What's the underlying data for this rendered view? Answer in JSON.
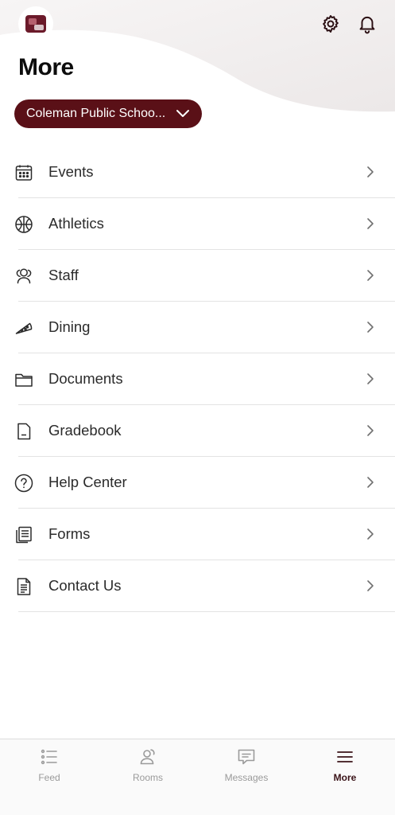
{
  "header": {
    "title": "More",
    "school_selector": "Coleman Public Schoo...",
    "icons": [
      "gear-icon",
      "bell-icon"
    ]
  },
  "menu": {
    "items": [
      {
        "label": "Events",
        "icon": "calendar-icon"
      },
      {
        "label": "Athletics",
        "icon": "basketball-icon"
      },
      {
        "label": "Staff",
        "icon": "staff-icon"
      },
      {
        "label": "Dining",
        "icon": "pizza-icon"
      },
      {
        "label": "Documents",
        "icon": "folder-icon"
      },
      {
        "label": "Gradebook",
        "icon": "gradebook-icon"
      },
      {
        "label": "Help Center",
        "icon": "help-icon"
      },
      {
        "label": "Forms",
        "icon": "forms-icon"
      },
      {
        "label": "Contact Us",
        "icon": "contact-icon"
      }
    ]
  },
  "tabbar": {
    "tabs": [
      {
        "label": "Feed",
        "icon": "feed-icon",
        "active": false
      },
      {
        "label": "Rooms",
        "icon": "rooms-icon",
        "active": false
      },
      {
        "label": "Messages",
        "icon": "messages-icon",
        "active": false
      },
      {
        "label": "More",
        "icon": "menu-icon",
        "active": true
      }
    ]
  },
  "colors": {
    "accent": "#5a1017",
    "active_tab": "#3a1318",
    "inactive_tab": "#9a9a9a"
  }
}
